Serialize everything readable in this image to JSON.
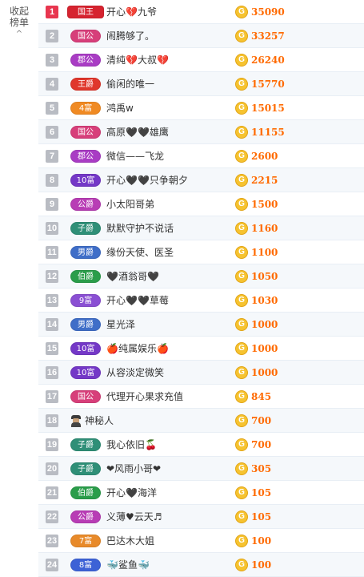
{
  "sidebar": {
    "collapse_line1": "收起",
    "collapse_line2": "榜单",
    "chevron": "^"
  },
  "coin_glyph": "G",
  "rows": [
    {
      "rank": "1",
      "badge": "国王",
      "badge_color": "#d6232f",
      "name": "开心💔九爷",
      "value": "35090"
    },
    {
      "rank": "2",
      "badge": "国公",
      "badge_color": "#d73f7a",
      "name": "闹腾够了。",
      "value": "33257"
    },
    {
      "rank": "3",
      "badge": "郡公",
      "badge_color": "#a93cc4",
      "name": "清纯💔大叔💔",
      "value": "26240"
    },
    {
      "rank": "4",
      "badge": "王爵",
      "badge_color": "#e0372c",
      "name": "偷闲的唯一",
      "value": "15770"
    },
    {
      "rank": "5",
      "badge": "4富",
      "badge_color": "#f08a23",
      "name": "鸿禹w",
      "value": "15015"
    },
    {
      "rank": "6",
      "badge": "国公",
      "badge_color": "#d73f7a",
      "name": "高原🖤🖤雄鹰",
      "value": "11155"
    },
    {
      "rank": "7",
      "badge": "郡公",
      "badge_color": "#a93cc4",
      "name": "微信——飞龙",
      "value": "2600"
    },
    {
      "rank": "8",
      "badge": "10富",
      "badge_color": "#7438c7",
      "name": "开心🖤🖤只争朝夕",
      "value": "2215"
    },
    {
      "rank": "9",
      "badge": "公爵",
      "badge_color": "#b83db5",
      "name": "小太阳哥弟",
      "value": "1500"
    },
    {
      "rank": "10",
      "badge": "子爵",
      "badge_color": "#2f8f77",
      "name": "默默守护不说话",
      "value": "1160"
    },
    {
      "rank": "11",
      "badge": "男爵",
      "badge_color": "#3f6ec8",
      "name": "缘份天使、医圣",
      "value": "1100"
    },
    {
      "rank": "12",
      "badge": "伯爵",
      "badge_color": "#2a9d4a",
      "name": "🖤酒翁哥🖤",
      "value": "1050"
    },
    {
      "rank": "13",
      "badge": "9富",
      "badge_color": "#8a4fd3",
      "name": "开心🖤🖤草莓",
      "value": "1030"
    },
    {
      "rank": "14",
      "badge": "男爵",
      "badge_color": "#3f6ec8",
      "name": "星光泽",
      "value": "1000"
    },
    {
      "rank": "15",
      "badge": "10富",
      "badge_color": "#7438c7",
      "name": "🍎纯属娱乐🍎",
      "value": "1000"
    },
    {
      "rank": "16",
      "badge": "10富",
      "badge_color": "#7438c7",
      "name": "从容淡定微笑",
      "value": "1000"
    },
    {
      "rank": "17",
      "badge": "国公",
      "badge_color": "#d73f7a",
      "name": "代理开心果求充值",
      "value": "845"
    },
    {
      "rank": "18",
      "badge": "",
      "badge_color": "",
      "name": "神秘人",
      "value": "700"
    },
    {
      "rank": "19",
      "badge": "子爵",
      "badge_color": "#2f8f77",
      "name": "我心依旧🍒",
      "value": "700"
    },
    {
      "rank": "20",
      "badge": "子爵",
      "badge_color": "#2f8f77",
      "name": "❤风雨小哥❤",
      "value": "305"
    },
    {
      "rank": "21",
      "badge": "伯爵",
      "badge_color": "#2a9d4a",
      "name": "开心🖤海洋",
      "value": "105"
    },
    {
      "rank": "22",
      "badge": "公爵",
      "badge_color": "#b83db5",
      "name": "义薄♥云天♬",
      "value": "105"
    },
    {
      "rank": "23",
      "badge": "7富",
      "badge_color": "#e88a2a",
      "name": "巴达木大姐",
      "value": "100"
    },
    {
      "rank": "24",
      "badge": "8富",
      "badge_color": "#3d62d6",
      "name": "🐳鲨鱼🐳",
      "value": "100"
    }
  ]
}
